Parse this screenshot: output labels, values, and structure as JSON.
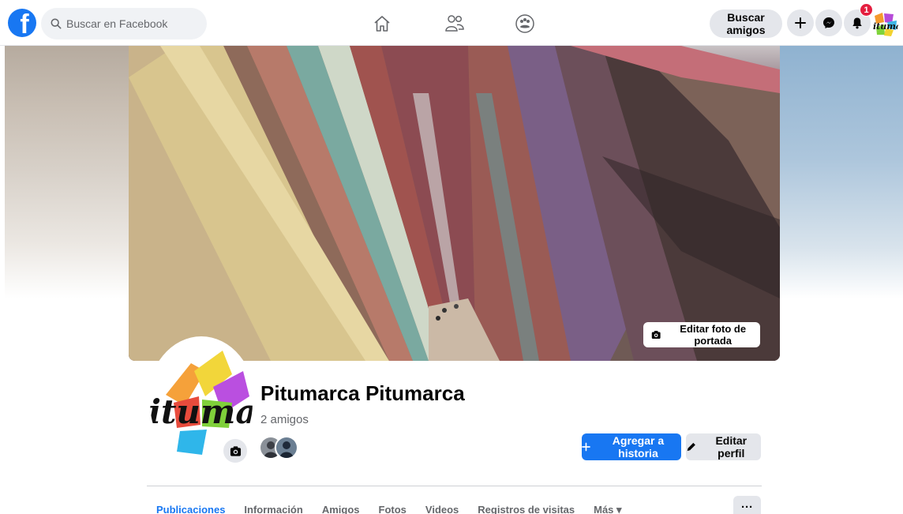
{
  "header": {
    "search_placeholder": "Buscar en Facebook",
    "find_friends_label": "Buscar amigos",
    "notifications_count": "1",
    "icons": [
      "facebook-logo",
      "home-icon",
      "friends-icon",
      "groups-icon",
      "plus-icon",
      "messenger-icon",
      "bell-icon"
    ]
  },
  "cover": {
    "edit_label": "Editar foto de portada"
  },
  "profile": {
    "name": "Pitumarca Pitumarca",
    "friends_count": "2 amigos",
    "avatar_text": "itumai",
    "top_avatar_text": "itumai"
  },
  "actions": {
    "add_story_label": "Agregar a historia",
    "edit_profile_label": "Editar perfil",
    "more_label": "···"
  },
  "tabs": [
    {
      "label": "Publicaciones",
      "active": true
    },
    {
      "label": "Información",
      "active": false
    },
    {
      "label": "Amigos",
      "active": false
    },
    {
      "label": "Fotos",
      "active": false
    },
    {
      "label": "Videos",
      "active": false
    },
    {
      "label": "Registros de visitas",
      "active": false
    },
    {
      "label": "Más ▾",
      "active": false
    }
  ],
  "colors": {
    "brand_blue": "#1877f2",
    "badge_red": "#e41e3f",
    "button_gray": "#e4e6eb"
  }
}
